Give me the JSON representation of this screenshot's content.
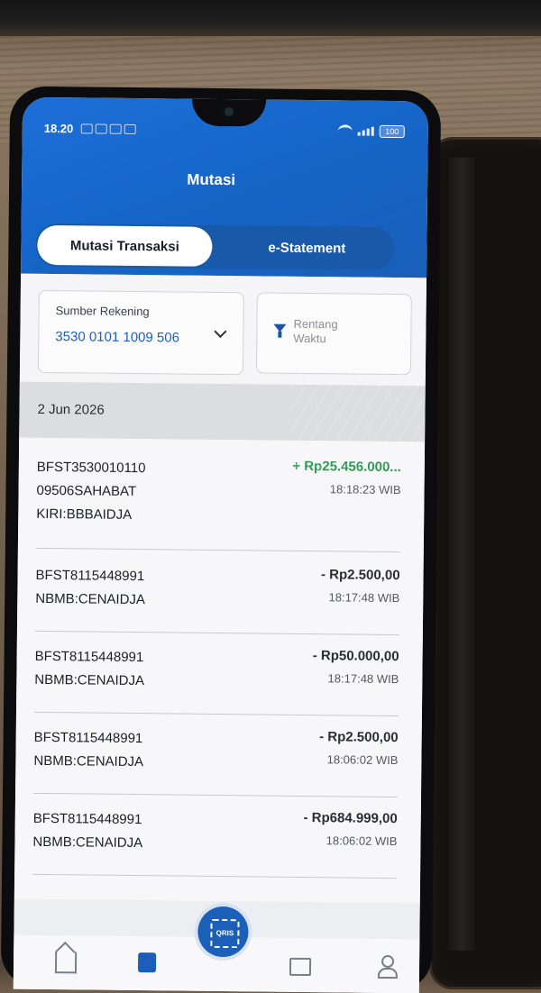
{
  "status_bar": {
    "time": "18.20",
    "battery": "100"
  },
  "header": {
    "title": "Mutasi"
  },
  "tabs": [
    {
      "label": "Mutasi Transaksi",
      "active": true
    },
    {
      "label": "e-Statement",
      "active": false
    }
  ],
  "filters": {
    "account_label": "Sumber Rekening",
    "account_number": "3530 0101 1009 506",
    "range_label": "Rentang Waktu"
  },
  "date_group": "2 Jun 2026",
  "transactions": [
    {
      "description": "BFST3530010110 09506SAHABAT KIRI:BBBAIDJA",
      "amount": "+ Rp25.456.000...",
      "time": "18:18:23 WIB",
      "type": "credit"
    },
    {
      "description": "BFST8115448991 NBMB:CENAIDJA",
      "amount": "- Rp2.500,00",
      "time": "18:17:48 WIB",
      "type": "debit"
    },
    {
      "description": "BFST8115448991 NBMB:CENAIDJA",
      "amount": "- Rp50.000,00",
      "time": "18:17:48 WIB",
      "type": "debit"
    },
    {
      "description": "BFST8115448991 NBMB:CENAIDJA",
      "amount": "- Rp2.500,00",
      "time": "18:06:02 WIB",
      "type": "debit"
    },
    {
      "description": "BFST8115448991 NBMB:CENAIDJA",
      "amount": "- Rp684.999,00",
      "time": "18:06:02 WIB",
      "type": "debit"
    }
  ],
  "bottom_nav": {
    "qris_label": "QRIS"
  },
  "colors": {
    "primary": "#1b5fb8",
    "credit": "#2a9a4f",
    "debit": "#2a2d34"
  },
  "icons": [
    "wifi-icon",
    "signal-icon",
    "battery-icon",
    "chevron-down-icon",
    "filter-icon",
    "qris-icon",
    "home-icon",
    "mutasi-icon",
    "mail-icon",
    "profile-icon"
  ]
}
